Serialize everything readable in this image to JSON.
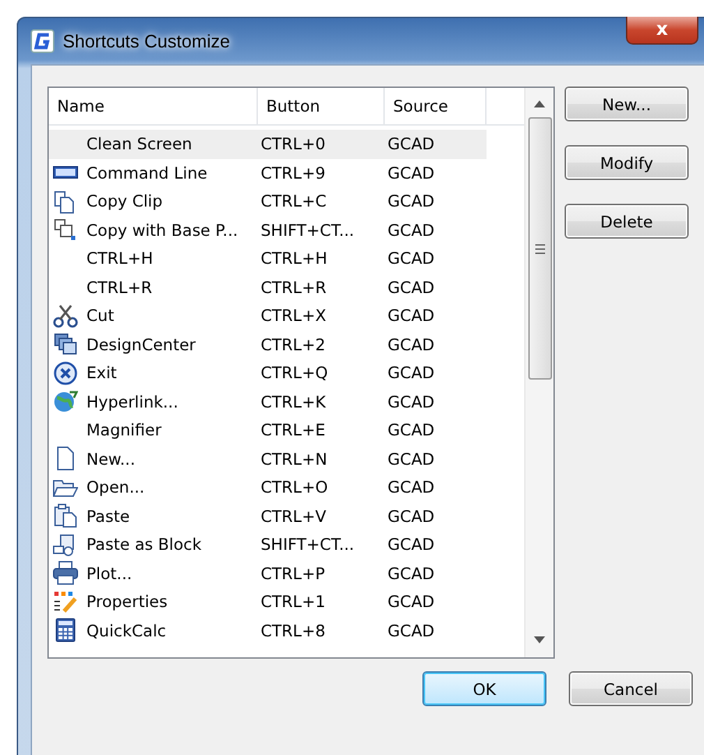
{
  "window": {
    "title": "Shortcuts Customize",
    "close": "x"
  },
  "table": {
    "columns": [
      "Name",
      "Button",
      "Source"
    ],
    "rows": [
      {
        "kind": "none",
        "name": "Clean Screen",
        "button": "CTRL+0",
        "source": "GCAD",
        "selected": true
      },
      {
        "kind": "command",
        "name": "Command Line",
        "button": "CTRL+9",
        "source": "GCAD",
        "selected": false
      },
      {
        "kind": "copy",
        "name": "Copy Clip",
        "button": "CTRL+C",
        "source": "GCAD",
        "selected": false
      },
      {
        "kind": "copybase",
        "name": "Copy with Base P...",
        "button": "SHIFT+CT...",
        "source": "GCAD",
        "selected": false
      },
      {
        "kind": "none",
        "name": "CTRL+H",
        "button": "CTRL+H",
        "source": "GCAD",
        "selected": false
      },
      {
        "kind": "none",
        "name": "CTRL+R",
        "button": "CTRL+R",
        "source": "GCAD",
        "selected": false
      },
      {
        "kind": "cut",
        "name": "Cut",
        "button": "CTRL+X",
        "source": "GCAD",
        "selected": false
      },
      {
        "kind": "design",
        "name": "DesignCenter",
        "button": "CTRL+2",
        "source": "GCAD",
        "selected": false
      },
      {
        "kind": "exit",
        "name": "Exit",
        "button": "CTRL+Q",
        "source": "GCAD",
        "selected": false
      },
      {
        "kind": "globe",
        "name": "Hyperlink...",
        "button": "CTRL+K",
        "source": "GCAD",
        "selected": false
      },
      {
        "kind": "none",
        "name": "Magnifier",
        "button": "CTRL+E",
        "source": "GCAD",
        "selected": false
      },
      {
        "kind": "new",
        "name": "New...",
        "button": "CTRL+N",
        "source": "GCAD",
        "selected": false
      },
      {
        "kind": "open",
        "name": "Open...",
        "button": "CTRL+O",
        "source": "GCAD",
        "selected": false
      },
      {
        "kind": "paste",
        "name": "Paste",
        "button": "CTRL+V",
        "source": "GCAD",
        "selected": false
      },
      {
        "kind": "pasteblock",
        "name": "Paste as Block",
        "button": "SHIFT+CT...",
        "source": "GCAD",
        "selected": false
      },
      {
        "kind": "plot",
        "name": "Plot...",
        "button": "CTRL+P",
        "source": "GCAD",
        "selected": false
      },
      {
        "kind": "properties",
        "name": "Properties",
        "button": "CTRL+1",
        "source": "GCAD",
        "selected": false
      },
      {
        "kind": "calc",
        "name": "QuickCalc",
        "button": "CTRL+8",
        "source": "GCAD",
        "selected": false
      }
    ]
  },
  "side_buttons": [
    "New...",
    "Modify",
    "Delete"
  ],
  "buttons": [
    {
      "label": "OK",
      "default": true
    },
    {
      "label": "Cancel",
      "default": false
    }
  ]
}
